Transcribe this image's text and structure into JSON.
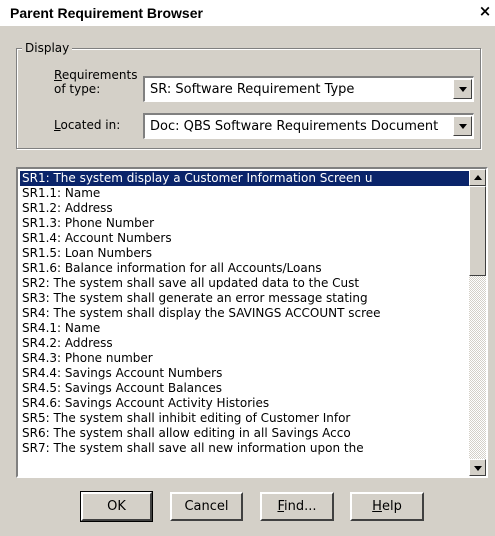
{
  "window": {
    "title": "Parent Requirement Browser",
    "close_glyph": "×"
  },
  "display_group": {
    "label": "Display",
    "requirements_of_type": {
      "label_line1_mnemonic": "R",
      "label_line1_rest": "equirements",
      "label_line2": "of type:",
      "value": "SR: Software Requirement Type"
    },
    "located_in": {
      "label_mnemonic": "L",
      "label_rest": "ocated in:",
      "value": "Doc: QBS Software Requirements Document"
    }
  },
  "requirements_list": {
    "selected_index": 0,
    "items": [
      "SR1: The system display a Customer Information Screen u",
      "SR1.1: Name",
      "SR1.2: Address",
      "SR1.3: Phone Number",
      "SR1.4: Account Numbers",
      "SR1.5: Loan Numbers",
      "SR1.6: Balance information for all Accounts/Loans",
      "SR2: The system shall save all updated data to the Cust",
      "SR3: The system shall generate an error message stating",
      "SR4: The system shall display the SAVINGS ACCOUNT scree",
      "SR4.1: Name",
      "SR4.2: Address",
      "SR4.3: Phone number",
      "SR4.4: Savings Account Numbers",
      "SR4.5: Savings Account Balances",
      "SR4.6: Savings Account Activity Histories",
      "SR5: The system shall inhibit editing of Customer Infor",
      "SR6: The system shall allow editing in all Savings Acco",
      "SR7: The system shall save all new information upon the"
    ]
  },
  "buttons": {
    "ok": "OK",
    "cancel": "Cancel",
    "find_mnemonic": "F",
    "find_rest": "ind...",
    "help_mnemonic": "H",
    "help_rest": "elp"
  },
  "colors": {
    "dialog_face": "#d4d0c8",
    "selection": "#0a246a"
  },
  "icons": {
    "combo_arrow": "chevron-down-icon",
    "scroll_up": "scroll-up-arrow-icon",
    "scroll_down": "scroll-down-arrow-icon",
    "close": "close-icon"
  }
}
